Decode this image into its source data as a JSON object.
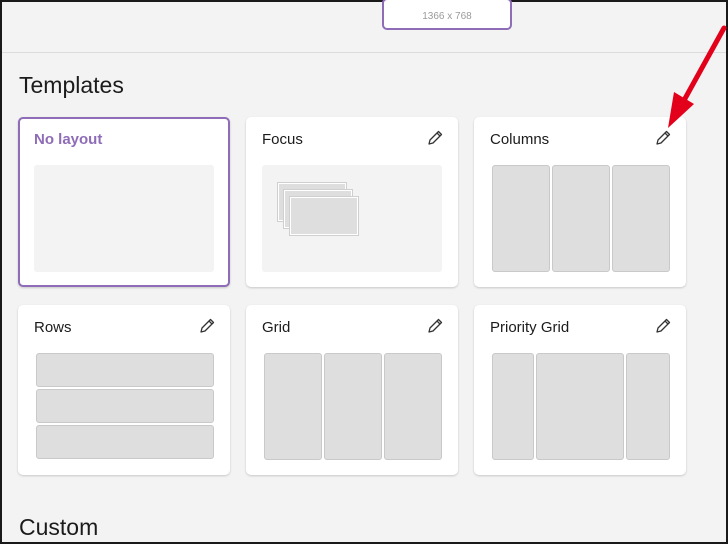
{
  "monitor": {
    "resolution": "1366 x 768"
  },
  "sections": {
    "templates_title": "Templates",
    "custom_title": "Custom"
  },
  "templates": [
    {
      "name": "No layout",
      "selected": true,
      "editable": false
    },
    {
      "name": "Focus",
      "selected": false,
      "editable": true
    },
    {
      "name": "Columns",
      "selected": false,
      "editable": true
    },
    {
      "name": "Rows",
      "selected": false,
      "editable": true
    },
    {
      "name": "Grid",
      "selected": false,
      "editable": true
    },
    {
      "name": "Priority Grid",
      "selected": false,
      "editable": true
    }
  ],
  "icons": {
    "edit": "pencil-icon",
    "annotation": "red-arrow-icon"
  },
  "colors": {
    "accent": "#8e6cb7",
    "annotation": "#e3001b"
  }
}
